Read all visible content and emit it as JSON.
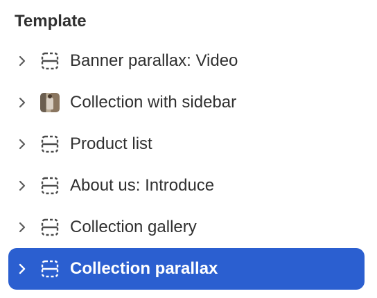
{
  "section": {
    "title": "Template"
  },
  "items": [
    {
      "label": "Banner parallax: Video",
      "icon": "section-layout-icon",
      "selected": false
    },
    {
      "label": "Collection with sidebar",
      "icon": "image-thumbnail",
      "selected": false
    },
    {
      "label": "Product list",
      "icon": "section-layout-icon",
      "selected": false
    },
    {
      "label": "About us: Introduce",
      "icon": "section-layout-icon",
      "selected": false
    },
    {
      "label": "Collection gallery",
      "icon": "section-layout-icon",
      "selected": false
    },
    {
      "label": "Collection parallax",
      "icon": "section-layout-icon",
      "selected": true
    }
  ],
  "colors": {
    "selected_bg": "#2b5fd0",
    "text": "#303030",
    "icon": "#4a4a4a",
    "selected_text": "#ffffff"
  }
}
